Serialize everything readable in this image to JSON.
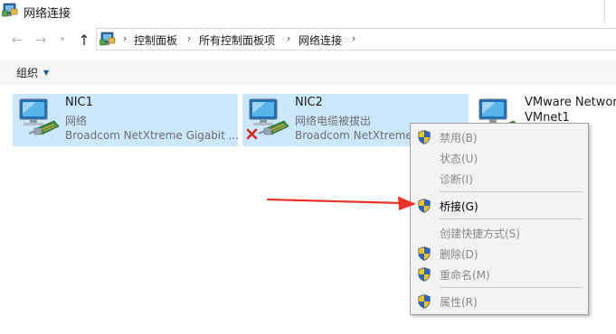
{
  "window": {
    "title": "网络连接"
  },
  "navigation": {
    "back_icon": "arrow-left-icon",
    "forward_icon": "arrow-right-icon",
    "recent_icon": "chevron-down-icon",
    "up_icon": "arrow-up-icon"
  },
  "address_bar": {
    "crumbs": [
      "控制面板",
      "所有控制面板项",
      "网络连接"
    ]
  },
  "toolbar": {
    "organize_label": "组织"
  },
  "connections": [
    {
      "name": "NIC1",
      "status": "网络",
      "device": "Broadcom NetXtreme Gigabit ...",
      "selected": true,
      "disconnected": false
    },
    {
      "name": "NIC2",
      "status": "网络电缆被拔出",
      "device": "Broadcom NetXtreme",
      "selected": true,
      "disconnected": true
    },
    {
      "name": "VMware Network",
      "status": "VMnet1",
      "device": "",
      "selected": false,
      "disconnected": false
    }
  ],
  "context_menu": {
    "items": [
      {
        "label": "禁用(B)",
        "enabled": false,
        "shield": true
      },
      {
        "label": "状态(U)",
        "enabled": false,
        "shield": false
      },
      {
        "label": "诊断(I)",
        "enabled": false,
        "shield": false
      },
      {
        "label": "桥接(G)",
        "enabled": true,
        "shield": true
      },
      {
        "label": "创建快捷方式(S)",
        "enabled": false,
        "shield": false
      },
      {
        "label": "删除(D)",
        "enabled": false,
        "shield": true
      },
      {
        "label": "重命名(M)",
        "enabled": false,
        "shield": true
      },
      {
        "label": "属性(R)",
        "enabled": false,
        "shield": true
      }
    ]
  },
  "colors": {
    "selection": "#cce8ff",
    "annotation_arrow": "#e8322a",
    "shield_blue": "#2f63c4",
    "shield_yellow": "#f6c513"
  }
}
